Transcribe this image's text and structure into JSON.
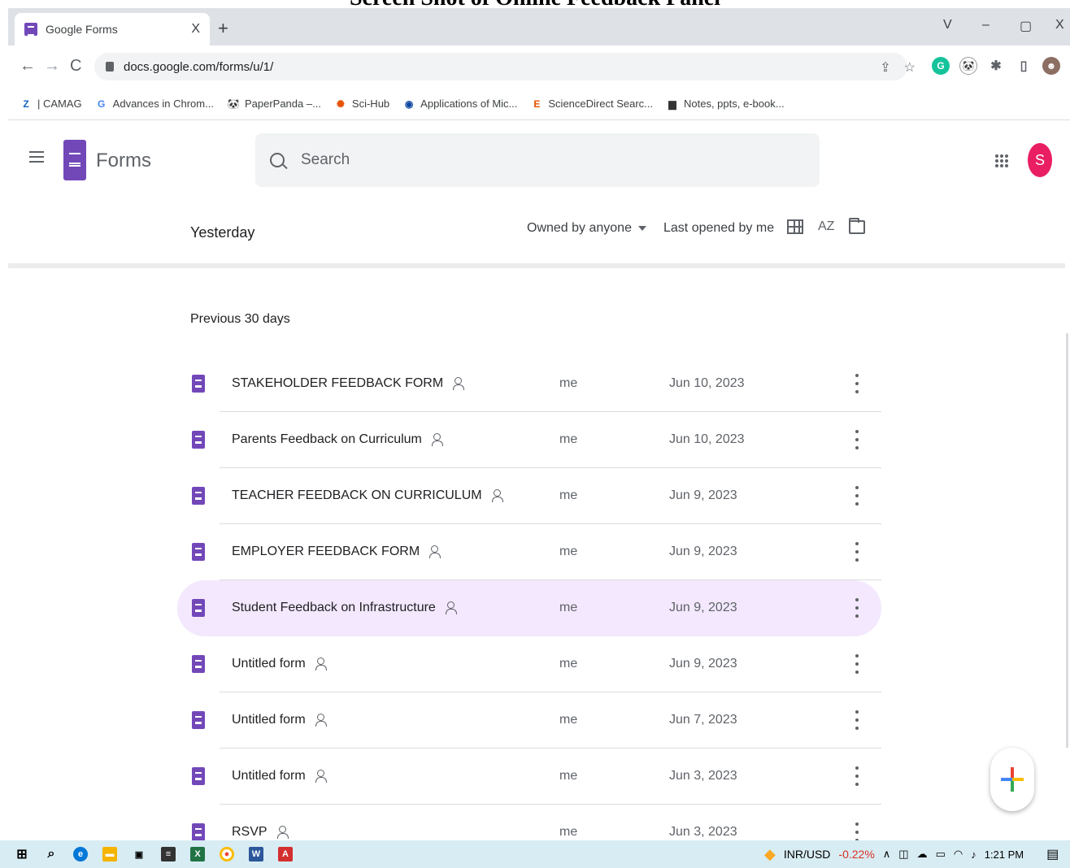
{
  "caption": "Screen Shot of Online Feedback Panel",
  "browser": {
    "tab_title": "Google Forms",
    "tab_close": "X",
    "new_tab": "+",
    "url": "docs.google.com/forms/u/1/",
    "window_controls": [
      "V",
      "–",
      "▢",
      "X"
    ],
    "bookmarks": [
      {
        "label": "| CAMAG",
        "icon": "Z",
        "color": "#1565c0"
      },
      {
        "label": "Advances in Chrom...",
        "icon": "G",
        "color": "#4285f4"
      },
      {
        "label": "PaperPanda –...",
        "icon": "🐼",
        "color": "#555555"
      },
      {
        "label": "Sci-Hub",
        "icon": "✺",
        "color": "#e65100"
      },
      {
        "label": "Applications of Mic...",
        "icon": "◉",
        "color": "#0d47a1"
      },
      {
        "label": "ScienceDirect Searc...",
        "icon": "E",
        "color": "#e65100"
      },
      {
        "label": "Notes, ppts, e-book...",
        "icon": "▆",
        "color": "#333333"
      }
    ]
  },
  "app": {
    "name": "Forms",
    "search_placeholder": "Search",
    "avatar_letter": "S"
  },
  "filters": {
    "section_heading": "Yesterday",
    "owner_filter": "Owned by anyone",
    "sort": "Last opened by me",
    "az": "AZ"
  },
  "list": {
    "section_heading": "Previous 30 days",
    "rows": [
      {
        "name": "STAKEHOLDER FEEDBACK FORM",
        "owner": "me",
        "date": "Jun 10, 2023",
        "highlight": false
      },
      {
        "name": "Parents Feedback on Curriculum",
        "owner": "me",
        "date": "Jun 10, 2023",
        "highlight": false
      },
      {
        "name": "TEACHER FEEDBACK ON CURRICULUM",
        "owner": "me",
        "date": "Jun 9, 2023",
        "highlight": false
      },
      {
        "name": "EMPLOYER FEEDBACK FORM",
        "owner": "me",
        "date": "Jun 9, 2023",
        "highlight": false
      },
      {
        "name": "Student Feedback on Infrastructure",
        "owner": "me",
        "date": "Jun 9, 2023",
        "highlight": true
      },
      {
        "name": "Untitled form",
        "owner": "me",
        "date": "Jun 9, 2023",
        "highlight": false
      },
      {
        "name": "Untitled form",
        "owner": "me",
        "date": "Jun 7, 2023",
        "highlight": false
      },
      {
        "name": "Untitled form",
        "owner": "me",
        "date": "Jun 3, 2023",
        "highlight": false
      },
      {
        "name": "RSVP",
        "owner": "me",
        "date": "Jun 3, 2023",
        "highlight": false
      }
    ]
  },
  "taskbar": {
    "ticker_label": "INR/USD",
    "ticker_change": "-0.22%",
    "time": "1:21 PM"
  }
}
